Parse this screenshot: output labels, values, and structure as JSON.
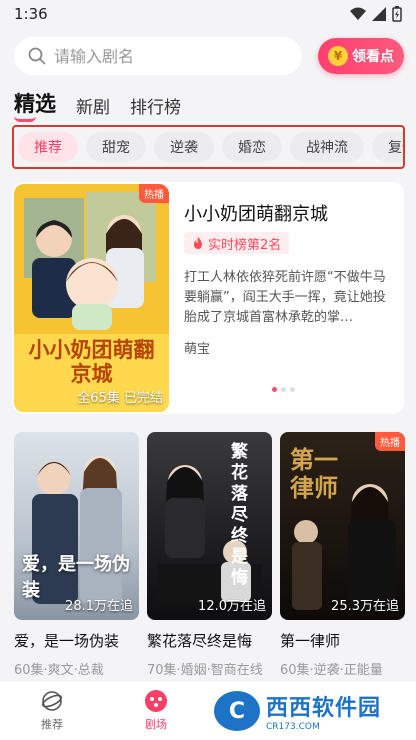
{
  "status": {
    "time": "1:36"
  },
  "search": {
    "placeholder": "请输入剧名"
  },
  "reward_button": {
    "label": "领看点",
    "coin_glyph": "¥"
  },
  "top_tabs": [
    {
      "label": "精选",
      "active": true
    },
    {
      "label": "新剧",
      "active": false
    },
    {
      "label": "排行榜",
      "active": false
    }
  ],
  "genres": [
    {
      "label": "推荐",
      "active": true
    },
    {
      "label": "甜宠"
    },
    {
      "label": "逆袭"
    },
    {
      "label": "婚恋"
    },
    {
      "label": "战神流"
    },
    {
      "label": "复仇"
    }
  ],
  "featured": {
    "title": "小小奶团萌翻京城",
    "rank": "实时榜第2名",
    "description": "打工人林依依猝死前许愿“不做牛马要躺赢”，阎王大手一挥，竟让她投胎成了京城首富林承乾的掌…",
    "tag": "萌宝",
    "hot_label": "热播",
    "episodes": "全65集",
    "status": "已完结",
    "poster_title": "小小奶团萌翻京城",
    "carousel_active_index": 0,
    "carousel_count": 3
  },
  "dramas": [
    {
      "title": "爱，是一场伪装",
      "meta": "60集·爽文·总裁",
      "count": "28.1万在追",
      "poster_text": "爱，是一场伪装",
      "hot": false
    },
    {
      "title": "繁花落尽终是悔",
      "meta": "70集·婚姻·智商在线",
      "count": "12.0万在追",
      "poster_text": "繁花落尽终是悔",
      "hot": false
    },
    {
      "title": "第一律师",
      "meta": "60集·逆袭·正能量",
      "count": "25.3万在追",
      "poster_text": "第一律师",
      "hot": true,
      "hot_label": "热播"
    }
  ],
  "bottom_nav": [
    {
      "label": "推荐",
      "active": false
    },
    {
      "label": "剧场",
      "active": true
    },
    {
      "label": "",
      "active": false
    },
    {
      "label": "",
      "active": false
    }
  ],
  "watermark": {
    "logo": "C",
    "main": "西西软件园",
    "sub": "CR173.COM"
  },
  "colors": {
    "accent": "#ff3d66",
    "chip_border": "#d43b2c",
    "background": "#f4f4f6"
  }
}
